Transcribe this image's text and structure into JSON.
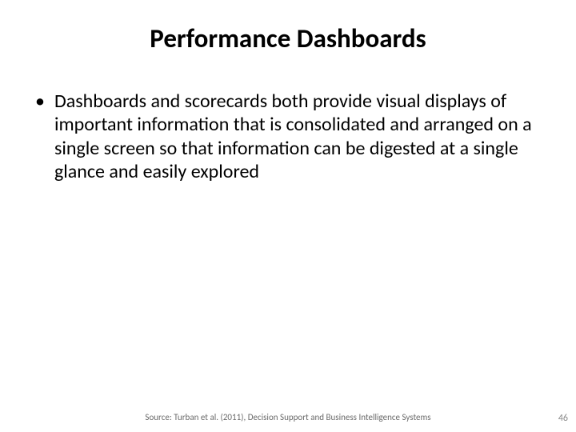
{
  "slide": {
    "title": "Performance Dashboards",
    "bullets": [
      "Dashboards and scorecards both provide visual displays of important information that is consolidated and arranged on a single screen so that information can be digested at a single glance and easily explored"
    ],
    "source": "Source: Turban et al. (2011), Decision Support and Business Intelligence Systems",
    "page_number": "46"
  }
}
